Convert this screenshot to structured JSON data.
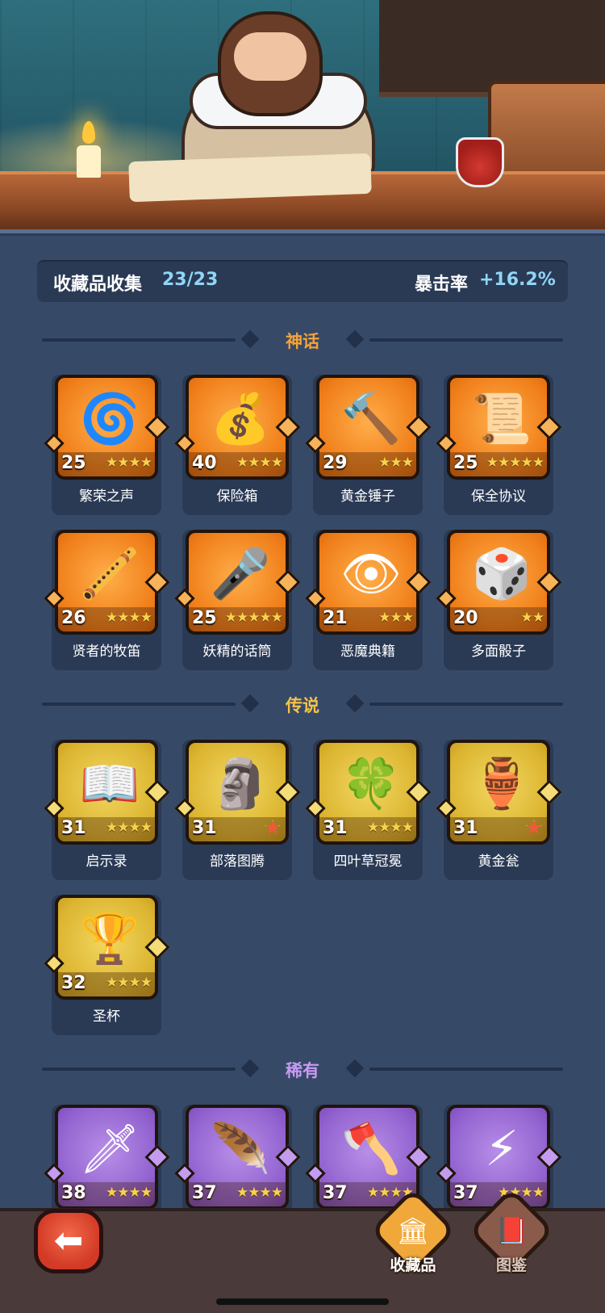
{
  "header": {
    "title": "收藏品收集",
    "count": "23/23",
    "crit_label": "暴击率",
    "crit_value": "+16.2%"
  },
  "sections": [
    {
      "label": "神话",
      "color": "#f6a23a",
      "rarity": "mythic",
      "items": [
        {
          "name": "繁荣之声",
          "level": "25",
          "stars": 4,
          "icon": "sound-orb-icon",
          "glyph": "🌀"
        },
        {
          "name": "保险箱",
          "level": "40",
          "stars": 4,
          "icon": "treasure-chest-icon",
          "glyph": "💰"
        },
        {
          "name": "黄金锤子",
          "level": "29",
          "stars": 3,
          "icon": "golden-hammer-icon",
          "glyph": "🔨"
        },
        {
          "name": "保全协议",
          "level": "25",
          "stars": 5,
          "icon": "contract-scroll-icon",
          "glyph": "📜"
        },
        {
          "name": "贤者的牧笛",
          "level": "26",
          "stars": 4,
          "icon": "sage-flute-icon",
          "glyph": "🪈"
        },
        {
          "name": "妖精的话筒",
          "level": "25",
          "stars": 5,
          "icon": "fairy-microphone-icon",
          "glyph": "🎤"
        },
        {
          "name": "恶魔典籍",
          "level": "21",
          "stars": 3,
          "icon": "demon-tome-icon",
          "glyph": "👁"
        },
        {
          "name": "多面骰子",
          "level": "20",
          "stars": 2,
          "icon": "polyhedral-dice-icon",
          "glyph": "🎲"
        }
      ]
    },
    {
      "label": "传说",
      "color": "#f2c24a",
      "rarity": "legend",
      "items": [
        {
          "name": "启示录",
          "level": "31",
          "stars": 4,
          "icon": "open-book-icon",
          "glyph": "📖"
        },
        {
          "name": "部落图腾",
          "level": "31",
          "stars": 0,
          "red_star": true,
          "icon": "tribal-totem-icon",
          "glyph": "🗿"
        },
        {
          "name": "四叶草冠冕",
          "level": "31",
          "stars": 4,
          "icon": "clover-crown-icon",
          "glyph": "🍀"
        },
        {
          "name": "黄金瓮",
          "level": "31",
          "stars": 0,
          "red_star": true,
          "icon": "golden-urn-icon",
          "glyph": "🏺"
        },
        {
          "name": "圣杯",
          "level": "32",
          "stars": 4,
          "icon": "holy-grail-icon",
          "glyph": "🏆"
        }
      ]
    },
    {
      "label": "稀有",
      "color": "#c79af2",
      "rarity": "rare",
      "items": [
        {
          "name": "",
          "level": "38",
          "stars": 4,
          "icon": "ice-dagger-icon",
          "glyph": "🗡"
        },
        {
          "name": "",
          "level": "37",
          "stars": 4,
          "icon": "fire-feather-icon",
          "glyph": "🪶"
        },
        {
          "name": "",
          "level": "37",
          "stars": 4,
          "icon": "stone-axe-icon",
          "glyph": "🪓"
        },
        {
          "name": "",
          "level": "37",
          "stars": 4,
          "icon": "lightning-card-icon",
          "glyph": "⚡"
        }
      ]
    }
  ],
  "nav": {
    "back_glyph": "⬅",
    "tabs": [
      {
        "label": "收藏品",
        "active": true,
        "icon": "collection-icon",
        "glyph": "🏛"
      },
      {
        "label": "图鉴",
        "active": false,
        "icon": "codex-book-icon",
        "glyph": "📕"
      }
    ]
  }
}
